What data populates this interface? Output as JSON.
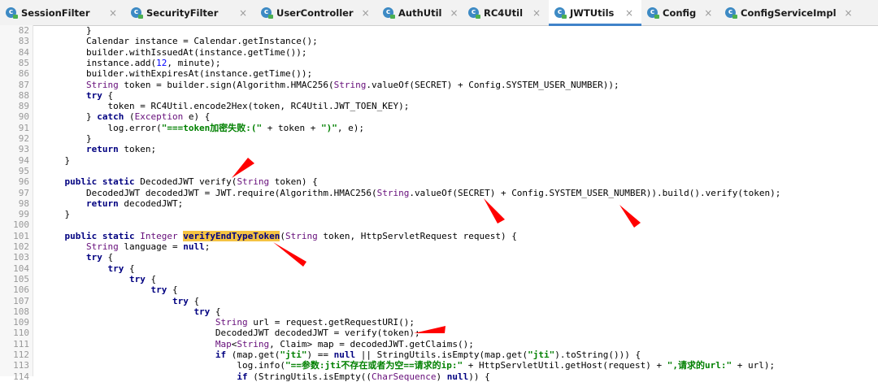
{
  "tabs": [
    {
      "label": "SessionFilter",
      "active": false,
      "icon": "java-class-icon"
    },
    {
      "label": "SecurityFilter",
      "active": false,
      "icon": "java-class-icon"
    },
    {
      "label": "UserController",
      "active": false,
      "icon": "java-class-icon"
    },
    {
      "label": "AuthUtil",
      "active": false,
      "icon": "java-class-icon"
    },
    {
      "label": "RC4Util",
      "active": false,
      "icon": "java-class-icon"
    },
    {
      "label": "JWTUtils",
      "active": true,
      "icon": "java-class-icon"
    },
    {
      "label": "Config",
      "active": false,
      "icon": "java-class-icon"
    },
    {
      "label": "ConfigServiceImpl",
      "active": false,
      "icon": "java-class-icon"
    }
  ],
  "close_glyph": "×",
  "colors": {
    "keyword": "#000080",
    "string": "#008000",
    "number": "#0000ff",
    "type": "#660e7a",
    "highlight": "#f5c342",
    "arrow": "#ff0000",
    "active_tab_underline": "#4083c9"
  },
  "line_numbers": [
    "82",
    "83",
    "84",
    "85",
    "86",
    "87",
    "88",
    "89",
    "90",
    "91",
    "92",
    "93",
    "94",
    "95",
    "96",
    "97",
    "98",
    "99",
    "100",
    "101",
    "102",
    "103",
    "104",
    "105",
    "106",
    "107",
    "108",
    "109",
    "110",
    "111",
    "112",
    "113",
    "114"
  ],
  "code_lines": [
    [
      {
        "t": "        }"
      }
    ],
    [
      {
        "t": "        Calendar instance = Calendar.getInstance();"
      }
    ],
    [
      {
        "t": "        builder.withIssuedAt(instance.getTime());"
      }
    ],
    [
      {
        "t": "        instance.add("
      },
      {
        "t": "12",
        "c": "nm"
      },
      {
        "t": ", minute);"
      }
    ],
    [
      {
        "t": "        builder.withExpiresAt(instance.getTime());"
      }
    ],
    [
      {
        "t": "        String",
        "c": "ty"
      },
      {
        "t": " token = builder.sign(Algorithm.HMAC256("
      },
      {
        "t": "String",
        "c": "ty"
      },
      {
        "t": ".valueOf(SECRET) + Config.SYSTEM_USER_NUMBER));"
      }
    ],
    [
      {
        "t": "        "
      },
      {
        "t": "try",
        "c": "kw"
      },
      {
        "t": " {"
      }
    ],
    [
      {
        "t": "            token = RC4Util.encode2Hex(token, RC4Util.JWT_TOEN_KEY);"
      }
    ],
    [
      {
        "t": "        } "
      },
      {
        "t": "catch",
        "c": "kw"
      },
      {
        "t": " ("
      },
      {
        "t": "Exception",
        "c": "ty"
      },
      {
        "t": " e) {"
      }
    ],
    [
      {
        "t": "            log.error("
      },
      {
        "t": "\"===token加密失败:(\"",
        "c": "st"
      },
      {
        "t": " + token + "
      },
      {
        "t": "\")\"",
        "c": "st"
      },
      {
        "t": ", e);"
      }
    ],
    [
      {
        "t": "        }"
      }
    ],
    [
      {
        "t": "        "
      },
      {
        "t": "return",
        "c": "kw"
      },
      {
        "t": " token;"
      }
    ],
    [
      {
        "t": "    }"
      }
    ],
    [
      {
        "t": ""
      }
    ],
    [
      {
        "t": "    "
      },
      {
        "t": "public static",
        "c": "kw"
      },
      {
        "t": " DecodedJWT verify("
      },
      {
        "t": "String",
        "c": "ty"
      },
      {
        "t": " token) {"
      }
    ],
    [
      {
        "t": "        DecodedJWT decodedJWT = JWT.require(Algorithm.HMAC256("
      },
      {
        "t": "String",
        "c": "ty"
      },
      {
        "t": ".valueOf(SECRET) + Config.SYSTEM_USER_NUMBER)).build().verify(token);"
      }
    ],
    [
      {
        "t": "        "
      },
      {
        "t": "return",
        "c": "kw"
      },
      {
        "t": " decodedJWT;"
      }
    ],
    [
      {
        "t": "    }"
      }
    ],
    [
      {
        "t": ""
      }
    ],
    [
      {
        "t": "    "
      },
      {
        "t": "public static",
        "c": "kw"
      },
      {
        "t": " "
      },
      {
        "t": "Integer",
        "c": "ty"
      },
      {
        "t": " "
      },
      {
        "t": "verifyEndTypeToken",
        "c": "hl"
      },
      {
        "t": "("
      },
      {
        "t": "String",
        "c": "ty"
      },
      {
        "t": " token, HttpServletRequest request) {"
      }
    ],
    [
      {
        "t": "        "
      },
      {
        "t": "String",
        "c": "ty"
      },
      {
        "t": " language = "
      },
      {
        "t": "null",
        "c": "kw"
      },
      {
        "t": ";"
      }
    ],
    [
      {
        "t": "        "
      },
      {
        "t": "try",
        "c": "kw"
      },
      {
        "t": " {"
      }
    ],
    [
      {
        "t": "            "
      },
      {
        "t": "try",
        "c": "kw"
      },
      {
        "t": " {"
      }
    ],
    [
      {
        "t": "                "
      },
      {
        "t": "try",
        "c": "kw"
      },
      {
        "t": " {"
      }
    ],
    [
      {
        "t": "                    "
      },
      {
        "t": "try",
        "c": "kw"
      },
      {
        "t": " {"
      }
    ],
    [
      {
        "t": "                        "
      },
      {
        "t": "try",
        "c": "kw"
      },
      {
        "t": " {"
      }
    ],
    [
      {
        "t": "                            "
      },
      {
        "t": "try",
        "c": "kw"
      },
      {
        "t": " {"
      }
    ],
    [
      {
        "t": "                                "
      },
      {
        "t": "String",
        "c": "ty"
      },
      {
        "t": " url = request.getRequestURI();"
      }
    ],
    [
      {
        "t": "                                DecodedJWT decodedJWT = verify(token);"
      }
    ],
    [
      {
        "t": "                                "
      },
      {
        "t": "Map",
        "c": "ty"
      },
      {
        "t": "<"
      },
      {
        "t": "String",
        "c": "ty"
      },
      {
        "t": ", Claim> map = decodedJWT.getClaims();"
      }
    ],
    [
      {
        "t": "                                "
      },
      {
        "t": "if",
        "c": "kw"
      },
      {
        "t": " (map.get("
      },
      {
        "t": "\"jti\"",
        "c": "st"
      },
      {
        "t": ") == "
      },
      {
        "t": "null",
        "c": "kw"
      },
      {
        "t": " || StringUtils.isEmpty(map.get("
      },
      {
        "t": "\"jti\"",
        "c": "st"
      },
      {
        "t": ").toString())) {"
      }
    ],
    [
      {
        "t": "                                    log.info("
      },
      {
        "t": "\"==参数:jti不存在或者为空==请求的ip:\"",
        "c": "st"
      },
      {
        "t": " + HttpServletUtil.getHost(request) + "
      },
      {
        "t": "\",请求的url:\"",
        "c": "st"
      },
      {
        "t": " + url);"
      }
    ],
    [
      {
        "t": "                                    "
      },
      {
        "t": "if",
        "c": "kw"
      },
      {
        "t": " (StringUtils.isEmpty(("
      },
      {
        "t": "CharSequence",
        "c": "ty"
      },
      {
        "t": ") "
      },
      {
        "t": "null",
        "c": "kw"
      },
      {
        "t": ")) {"
      }
    ]
  ]
}
